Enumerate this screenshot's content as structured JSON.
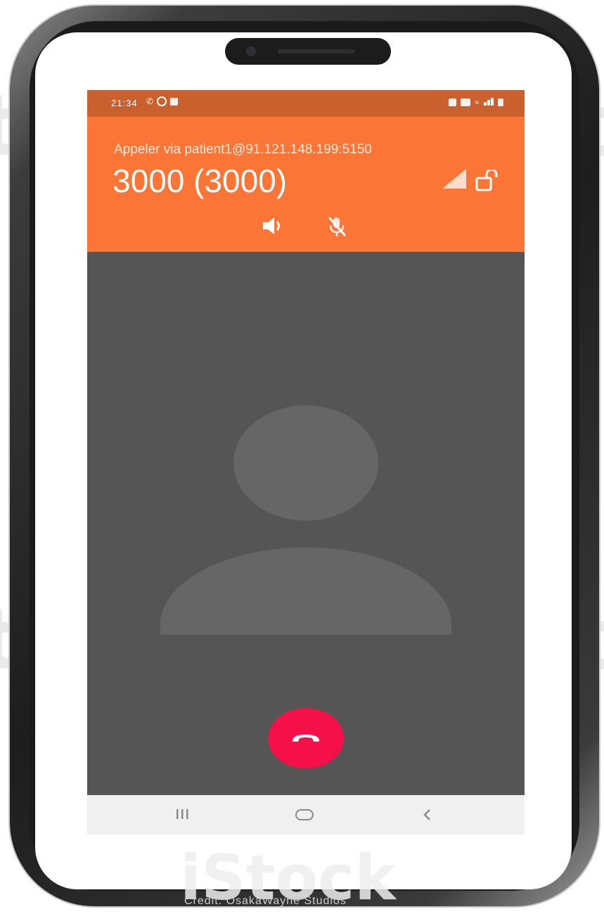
{
  "status_bar": {
    "time": "21:34"
  },
  "call": {
    "via_text": "Appeler via patient1@91.121.148.199:5150",
    "caller_name": "3000 (3000)"
  },
  "icons": {
    "signal": "signal-strength-icon",
    "lock": "unlock-icon",
    "speaker": "speaker-icon",
    "mute": "mic-off-icon",
    "hangup": "phone-hangup-icon",
    "avatar": "person-placeholder-icon"
  },
  "nav": {
    "recent": "recent-apps-icon",
    "home": "home-icon",
    "back": "back-icon"
  },
  "watermark": {
    "brand": "iStock",
    "credit": "Credit: OsakaWayne Studios"
  },
  "colors": {
    "header": "#fb7536",
    "status_bar": "#c9602e",
    "content_bg": "#555555",
    "hangup": "#f5104a"
  }
}
